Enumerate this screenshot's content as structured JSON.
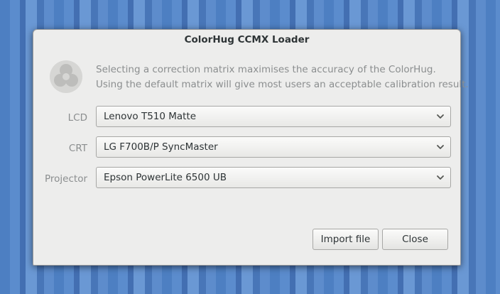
{
  "window": {
    "title": "ColorHug CCMX Loader"
  },
  "icon": "colorhug-logo-icon",
  "description": {
    "line1": "Selecting a correction matrix maximises the accuracy of the ColorHug.",
    "line2": "Using the default matrix will give most users an acceptable calibration result."
  },
  "rows": [
    {
      "label": "LCD",
      "value": "Lenovo T510 Matte"
    },
    {
      "label": "CRT",
      "value": "LG F700B/P SyncMaster"
    },
    {
      "label": "Projector",
      "value": "Epson PowerLite 6500 UB"
    }
  ],
  "buttons": {
    "import_label": "Import file",
    "close_label": "Close"
  },
  "colors": {
    "desktop": "#5b8ccd",
    "dialog_bg": "#ededec",
    "muted_text": "#8b8e8f",
    "text": "#2e3436"
  }
}
